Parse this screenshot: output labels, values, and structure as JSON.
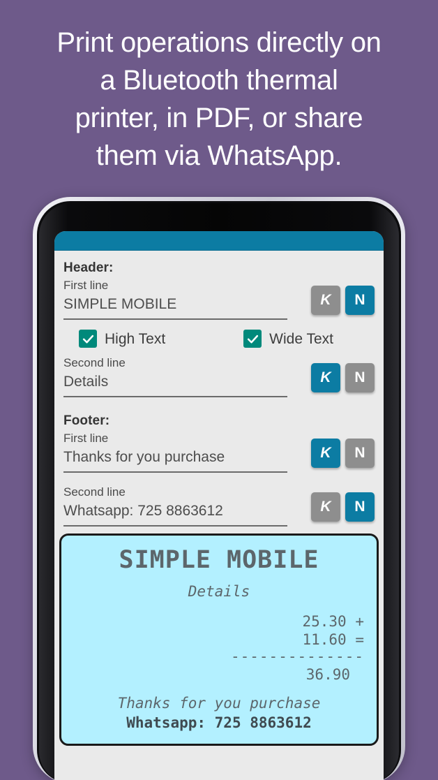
{
  "headline": {
    "lines": [
      "Print operations directly on",
      "a Bluetooth thermal",
      "printer, in PDF, or share",
      "them via WhatsApp."
    ]
  },
  "colors": {
    "background": "#6E5A8A",
    "appbar": "#0C7CA3",
    "accent_on": "#0C7CA3",
    "accent_off": "#8E8E8E",
    "checkbox": "#00897B",
    "form_bg": "#EAEAEA",
    "receipt_bg": "#B3F0FF"
  },
  "app": {
    "sections": [
      {
        "title": "Header:",
        "fields": [
          {
            "label": "First line",
            "value": "SIMPLE MOBILE",
            "k_label": "K",
            "n_label": "N",
            "k_state": "off",
            "n_state": "on"
          },
          {
            "label": "Second line",
            "value": "Details",
            "k_label": "K",
            "n_label": "N",
            "k_state": "on",
            "n_state": "off"
          }
        ]
      },
      {
        "title": "Footer:",
        "fields": [
          {
            "label": "First line",
            "value": "Thanks for you purchase",
            "k_label": "K",
            "n_label": "N",
            "k_state": "on",
            "n_state": "off"
          },
          {
            "label": "Second line",
            "value": "Whatsapp: 725 8863612",
            "k_label": "K",
            "n_label": "N",
            "k_state": "off",
            "n_state": "on"
          }
        ]
      }
    ],
    "checkboxes": [
      {
        "label": "High Text",
        "checked": true
      },
      {
        "label": "Wide Text",
        "checked": true
      }
    ],
    "receipt": {
      "title": "SIMPLE MOBILE",
      "subtitle": "Details",
      "amount_1": "25.30 +",
      "amount_2": "11.60 =",
      "separator": "--------------",
      "total": "36.90",
      "thanks": "Thanks for you purchase",
      "whatsapp": "Whatsapp: 725 8863612"
    }
  }
}
